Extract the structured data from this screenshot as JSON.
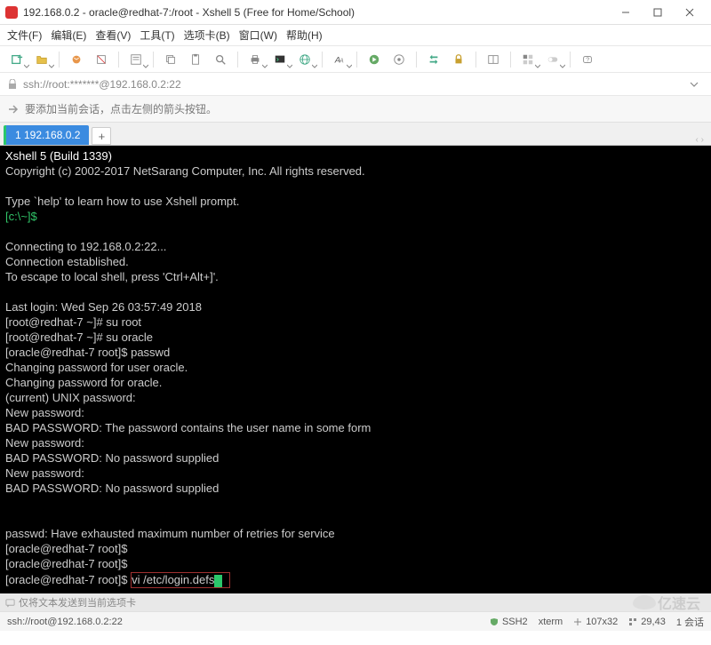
{
  "window": {
    "title": "192.168.0.2 - oracle@redhat-7:/root - Xshell 5 (Free for Home/School)"
  },
  "menu": {
    "file": "文件(F)",
    "edit": "编辑(E)",
    "view": "查看(V)",
    "tools": "工具(T)",
    "tabs": "选项卡(B)",
    "window": "窗口(W)",
    "help": "帮助(H)"
  },
  "address": {
    "url": "ssh://root:*******@192.168.0.2:22"
  },
  "hint": {
    "text": "要添加当前会话，点击左侧的箭头按钮。"
  },
  "tabs": {
    "active": "1 192.168.0.2",
    "new": "+",
    "nav": "‹  ›"
  },
  "terminal": {
    "l1": "Xshell 5 (Build 1339)",
    "l2": "Copyright (c) 2002-2017 NetSarang Computer, Inc. All rights reserved.",
    "l3": "",
    "l4": "Type `help' to learn how to use Xshell prompt.",
    "l5a": "[c:\\~]$",
    "l6": "",
    "l7": "Connecting to 192.168.0.2:22...",
    "l8": "Connection established.",
    "l9": "To escape to local shell, press 'Ctrl+Alt+]'.",
    "l10": "",
    "l11": "Last login: Wed Sep 26 03:57:49 2018",
    "l12": "[root@redhat-7 ~]# su root",
    "l13": "[root@redhat-7 ~]# su oracle",
    "l14": "[oracle@redhat-7 root]$ passwd",
    "l15": "Changing password for user oracle.",
    "l16": "Changing password for oracle.",
    "l17": "(current) UNIX password:",
    "l18": "New password:",
    "l19": "BAD PASSWORD: The password contains the user name in some form",
    "l20": "New password:",
    "l21": "BAD PASSWORD: No password supplied",
    "l22": "New password:",
    "l23": "BAD PASSWORD: No password supplied",
    "l24": "",
    "l25": "",
    "l26": "passwd: Have exhausted maximum number of retries for service",
    "l27": "[oracle@redhat-7 root]$",
    "l28": "[oracle@redhat-7 root]$",
    "l29p": "[oracle@redhat-7 root]$ ",
    "l29cmd": "vi /etc/login.defs"
  },
  "footer": {
    "hint": "仅将文本发送到当前选项卡",
    "watermark": "亿速云"
  },
  "status": {
    "left": "ssh://root@192.168.0.2:22",
    "ssh": "SSH2",
    "term": "xterm",
    "size": "107x32",
    "pos": "29,43",
    "sessions": "1 会话"
  }
}
